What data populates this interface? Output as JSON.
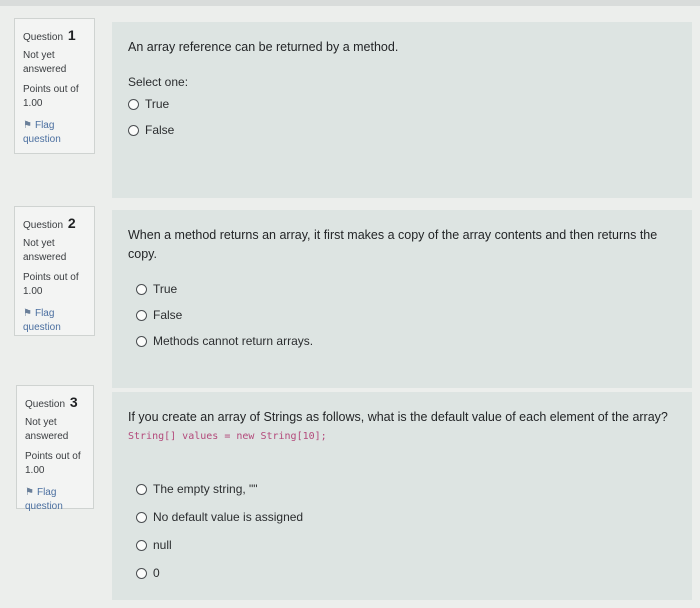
{
  "questions": [
    {
      "label": "Question",
      "number": "1",
      "state": "Not yet answered",
      "grade": "Points out of 1.00",
      "flag": "Flag question",
      "text": "An array reference can be returned by a method.",
      "prompt": "Select one:",
      "options": [
        "True",
        "False"
      ]
    },
    {
      "label": "Question",
      "number": "2",
      "state": "Not yet answered",
      "grade": "Points out of 1.00",
      "flag": "Flag question",
      "text": "When a method returns an array, it first makes a copy of the array contents and then returns the copy.",
      "options": [
        "True",
        "False",
        "Methods cannot return arrays."
      ]
    },
    {
      "label": "Question",
      "number": "3",
      "state": "Not yet answered",
      "grade": "Points out of 1.00",
      "flag": "Flag question",
      "text": "If you create an array of Strings as follows, what is the default value of each element of the array?",
      "code": "String[] values = new String[10];",
      "options": [
        "The empty string, \"\"",
        "No default value is assigned",
        "null",
        "0"
      ]
    }
  ]
}
